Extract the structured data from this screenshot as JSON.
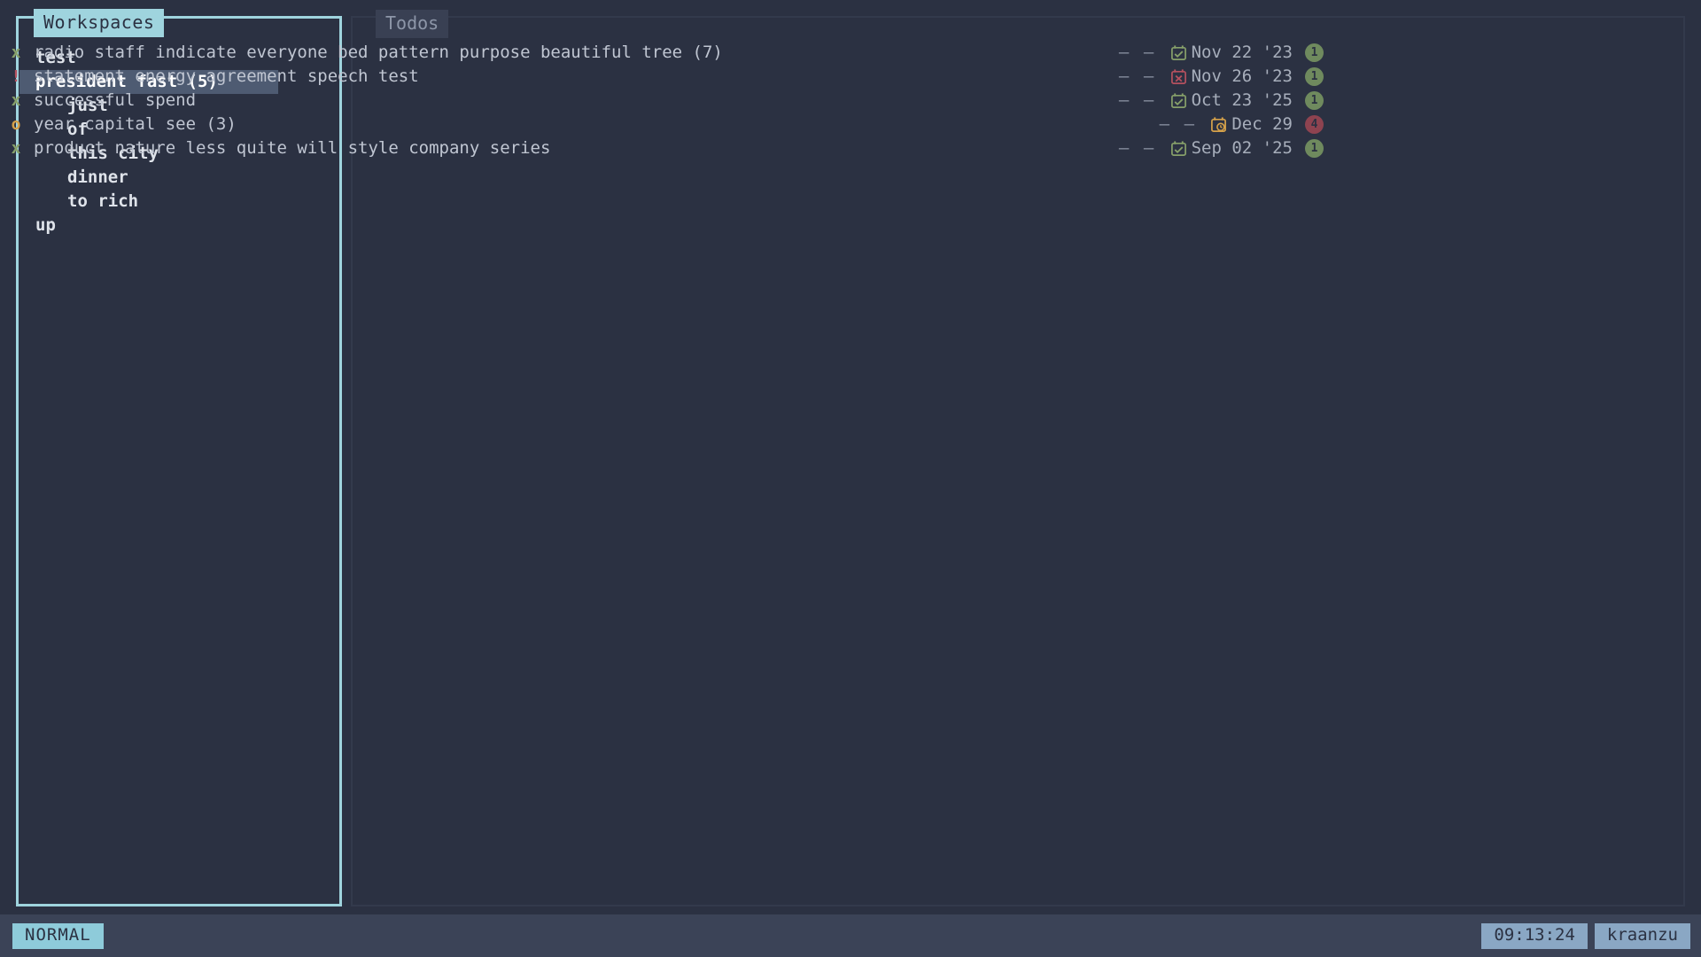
{
  "app": {
    "background": "#2b3142",
    "accent": "#9fd4de"
  },
  "workspaces": {
    "tab_label": "Workspaces",
    "items": [
      {
        "label": "test",
        "level": 1,
        "selected": false,
        "bold": true
      },
      {
        "label": "president fast (5)",
        "level": 1,
        "selected": true,
        "bold": true
      },
      {
        "label": "just",
        "level": 2,
        "selected": false,
        "bold": true
      },
      {
        "label": "of",
        "level": 2,
        "selected": false,
        "bold": true
      },
      {
        "label": "this city",
        "level": 2,
        "selected": false,
        "bold": true
      },
      {
        "label": "dinner",
        "level": 2,
        "selected": false,
        "bold": true
      },
      {
        "label": "to rich",
        "level": 2,
        "selected": false,
        "bold": true
      },
      {
        "label": "up",
        "level": 1,
        "selected": false,
        "bold": true
      }
    ]
  },
  "todos": {
    "tab_label": "Todos",
    "dash_placeholder": "–",
    "items": [
      {
        "status": "x",
        "status_kind": "done",
        "description": "radio staff indicate everyone bed pattern purpose beautiful tree (7)",
        "urgency": "–",
        "tags": "–",
        "due_icon": "calendar-check-icon",
        "due_icon_color": "#87a06a",
        "due_date": "Nov 22 '23",
        "badge_value": "1",
        "badge_kind": "green"
      },
      {
        "status": "!",
        "status_kind": "overdue",
        "description": "statement energy agreement speech test",
        "urgency": "–",
        "tags": "–",
        "due_icon": "calendar-x-icon",
        "due_icon_color": "#b5515f",
        "due_date": "Nov 26 '23",
        "badge_value": "1",
        "badge_kind": "green"
      },
      {
        "status": "x",
        "status_kind": "done",
        "description": "successful spend",
        "urgency": "–",
        "tags": "–",
        "due_icon": "calendar-check-icon",
        "due_icon_color": "#87a06a",
        "due_date": "Oct 23 '25",
        "badge_value": "1",
        "badge_kind": "green"
      },
      {
        "status": "o",
        "status_kind": "pending",
        "description": "year capital see (3)",
        "urgency": "–",
        "tags": "–",
        "due_icon": "calendar-clock-icon",
        "due_icon_color": "#d5a14a",
        "due_date": "Dec 29",
        "badge_value": "4",
        "badge_kind": "red"
      },
      {
        "status": "x",
        "status_kind": "done",
        "description": "product nature less quite will style company series",
        "urgency": "–",
        "tags": "–",
        "due_icon": "calendar-check-icon",
        "due_icon_color": "#87a06a",
        "due_date": "Sep 02 '25",
        "badge_value": "1",
        "badge_kind": "green"
      }
    ]
  },
  "status_bar": {
    "mode": "NORMAL",
    "clock": "09:13:24",
    "user": "kraanzu"
  }
}
